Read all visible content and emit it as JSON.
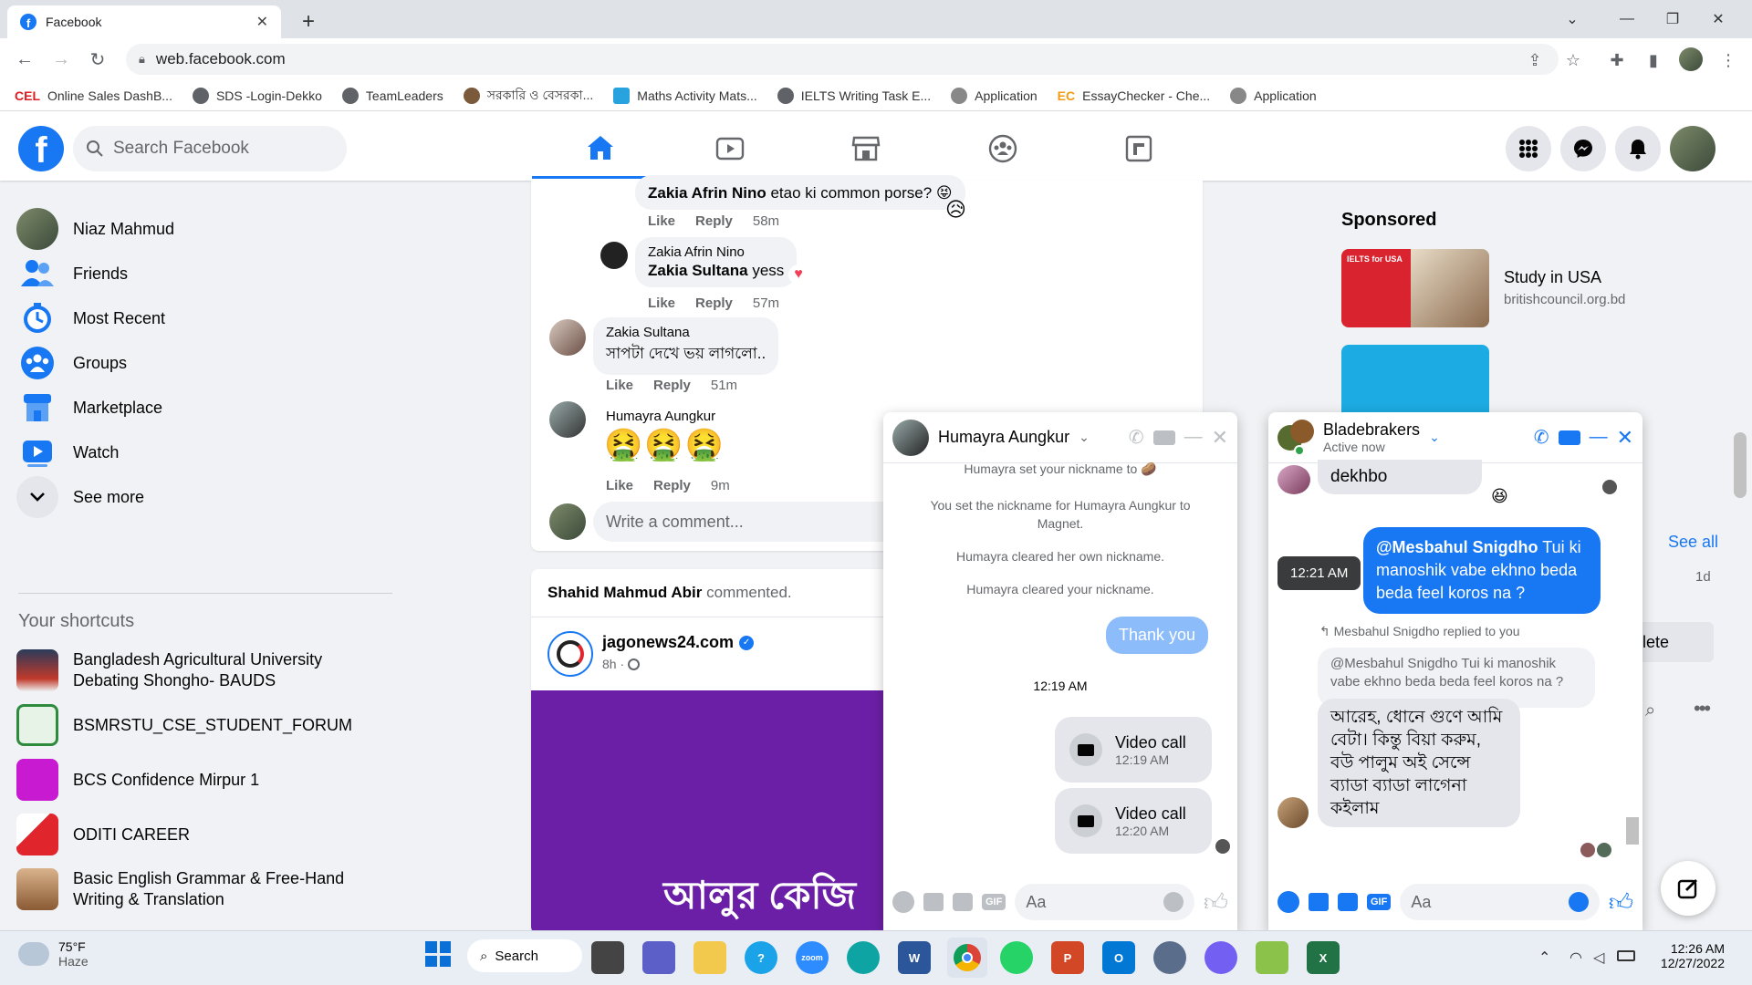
{
  "browser": {
    "tab_title": "Facebook",
    "url": "web.facebook.com",
    "bookmarks": [
      {
        "label": "Online Sales DashB..."
      },
      {
        "label": "SDS -Login-Dekko"
      },
      {
        "label": "TeamLeaders"
      },
      {
        "label": "সরকারি ও বেসরকা..."
      },
      {
        "label": "Maths Activity Mats..."
      },
      {
        "label": "IELTS Writing Task E..."
      },
      {
        "label": "Application"
      },
      {
        "label": "EssayChecker - Che..."
      },
      {
        "label": "Application"
      }
    ]
  },
  "header": {
    "search_placeholder": "Search Facebook"
  },
  "sidebar": {
    "items": [
      {
        "label": "Niaz Mahmud"
      },
      {
        "label": "Friends"
      },
      {
        "label": "Most Recent"
      },
      {
        "label": "Groups"
      },
      {
        "label": "Marketplace"
      },
      {
        "label": "Watch"
      },
      {
        "label": "See more"
      }
    ],
    "shortcuts_title": "Your shortcuts",
    "shortcuts": [
      {
        "label": "Bangladesh Agricultural University Debating Shongho- BAUDS"
      },
      {
        "label": "BSMRSTU_CSE_STUDENT_FORUM"
      },
      {
        "label": "BCS Confidence Mirpur 1"
      },
      {
        "label": "ODITI CAREER"
      },
      {
        "label": "Basic English Grammar & Free-Hand Writing & Translation"
      }
    ]
  },
  "feed": {
    "comments": [
      {
        "tag": "Zakia Afrin Nino",
        "text": "etao ki common porse?",
        "like": "Like",
        "reply": "Reply",
        "time": "58m"
      },
      {
        "name": "Zakia Afrin Nino",
        "tag": "Zakia Sultana",
        "text": "yess",
        "like": "Like",
        "reply": "Reply",
        "time": "57m"
      },
      {
        "name": "Zakia Sultana",
        "text": "সাপটা দেখে ভয় লাগলো..",
        "like": "Like",
        "reply": "Reply",
        "time": "51m"
      },
      {
        "name": "Humayra Aungkur",
        "text": "🤮🤮🤮",
        "like": "Like",
        "reply": "Reply",
        "time": "9m"
      }
    ],
    "write_comment_placeholder": "Write a comment...",
    "post2": {
      "activity_name": "Shahid Mahmud Abir",
      "activity_text": "commented.",
      "page_name": "jagonews24.com",
      "time": "8h ·",
      "image_text": "আলুর কেজি"
    }
  },
  "right": {
    "sponsored_title": "Sponsored",
    "ad1": {
      "title": "Study in USA",
      "domain": "britishcouncil.org.bd",
      "thumb_text": "IELTS for USA"
    },
    "see_all": "See all",
    "time_1d": "1d",
    "delete_fragment": "lete"
  },
  "chat1": {
    "name": "Humayra Aungkur",
    "system_messages": [
      "Humayra set your nickname to",
      "You set the nickname for Humayra Aungkur to Magnet.",
      "Humayra cleared her own nickname.",
      "Humayra cleared your nickname."
    ],
    "outgoing": "Thank you",
    "time_divider": "12:19 AM",
    "calls": [
      {
        "label": "Video call",
        "time": "12:19 AM"
      },
      {
        "label": "Video call",
        "time": "12:20 AM"
      }
    ],
    "composer_placeholder": "Aa",
    "gif": "GIF"
  },
  "chat2": {
    "name": "Bladebrakers",
    "status": "Active now",
    "in_partial": "dekhbo",
    "tooltip_time": "12:21 AM",
    "outgoing_mention": "@Mesbahul Snigdho",
    "outgoing_text": "Tui ki manoshik vabe ekhno beda beda feel koros na ?",
    "reply_label": "Mesbahul Snigdho replied to you",
    "quoted": "@Mesbahul Snigdho Tui ki manoshik vabe ekhno beda beda feel koros na ?",
    "incoming": "আরেহ, ধোনে গুণে আমি বেটা। কিন্তু বিয়া করুম, বউ পালুম অই সেন্সে ব্যাডা ব্যাডা লাগেনা কইলাম",
    "composer_placeholder": "Aa",
    "gif": "GIF"
  },
  "taskbar": {
    "weather_temp": "75°F",
    "weather_desc": "Haze",
    "search_label": "Search",
    "clock_time": "12:26 AM",
    "clock_date": "12/27/2022"
  },
  "colors": {
    "fb_blue": "#1877f2",
    "bg": "#f0f2f5"
  }
}
